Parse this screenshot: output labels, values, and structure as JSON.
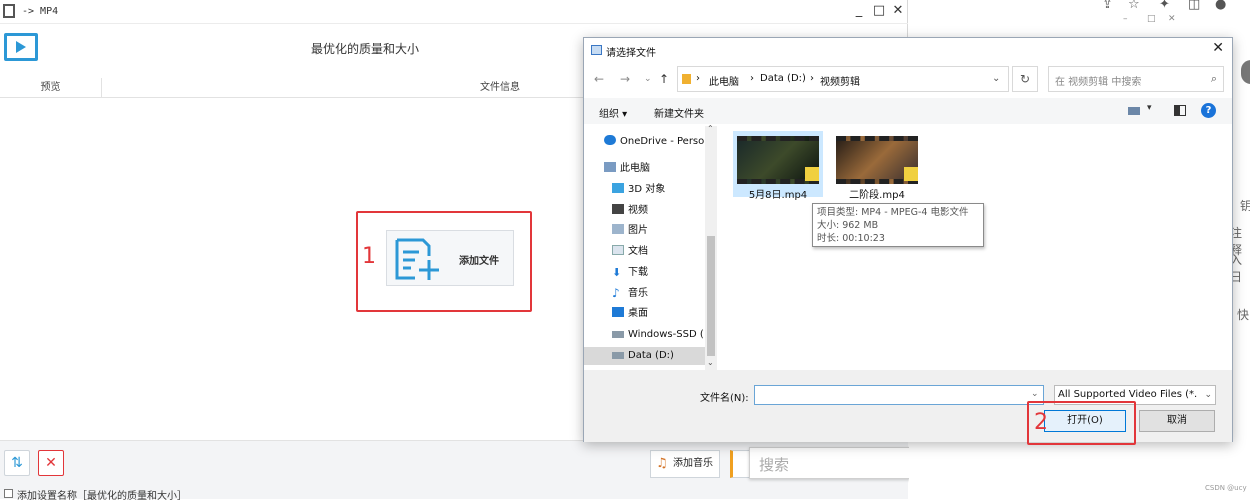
{
  "app": {
    "title": "-> MP4",
    "heading": "最优化的质量和大小",
    "col_preview": "预览",
    "col_fileinfo": "文件信息",
    "add_file_label": "添加文件",
    "add_music_label": "添加音乐",
    "save_setting_label": "添加设置名称［最优化的质量和大小］",
    "callout_1": "1",
    "callout_2": "2",
    "search_placeholder": "搜索"
  },
  "browser": {
    "right_text": [
      "钥",
      "注释",
      "入日",
      "快"
    ],
    "watermark": "CSDN @ucy"
  },
  "dialog": {
    "title": "请选择文件",
    "path": [
      "此电脑",
      "Data (D:)",
      "视频剪辑"
    ],
    "search_placeholder": "在 视频剪辑 中搜索",
    "organize": "组织 ▾",
    "new_folder": "新建文件夹",
    "nav_items": [
      {
        "label": "OneDrive - Perso",
        "icon": "cloud-icon"
      },
      {
        "label": "此电脑",
        "icon": "computer-icon"
      },
      {
        "label": "3D 对象",
        "icon": "3d-objects-icon"
      },
      {
        "label": "视频",
        "icon": "video-folder-icon"
      },
      {
        "label": "图片",
        "icon": "pictures-icon"
      },
      {
        "label": "文档",
        "icon": "documents-icon"
      },
      {
        "label": "下载",
        "icon": "download-icon"
      },
      {
        "label": "音乐",
        "icon": "music-icon"
      },
      {
        "label": "桌面",
        "icon": "desktop-icon"
      },
      {
        "label": "Windows-SSD (",
        "icon": "drive-icon"
      },
      {
        "label": "Data (D:)",
        "icon": "drive-icon"
      }
    ],
    "files": [
      {
        "name": "5月8日.mp4"
      },
      {
        "name": "二阶段.mp4"
      }
    ],
    "tooltip": {
      "type": "项目类型: MP4 - MPEG-4 电影文件",
      "size": "大小: 962 MB",
      "duration": "时长: 00:10:23"
    },
    "filename_label": "文件名(N):",
    "filename_value": "",
    "filetype": "All Supported Video Files (*.",
    "open": "打开(O)",
    "cancel": "取消"
  },
  "colors": {
    "accent": "#2c98d6",
    "highlight": "#e2363a"
  }
}
